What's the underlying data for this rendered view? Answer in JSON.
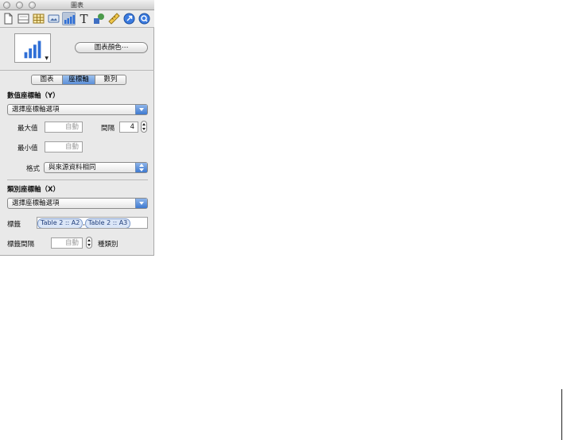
{
  "window": {
    "title": "圖表"
  },
  "toolbar": {
    "buttons": [
      {
        "icon": "document-icon"
      },
      {
        "icon": "layout-icon"
      },
      {
        "icon": "table-icon"
      },
      {
        "icon": "image-icon"
      },
      {
        "icon": "chart-icon",
        "selected": true
      },
      {
        "icon": "text-icon"
      },
      {
        "icon": "shapes-icon"
      },
      {
        "icon": "ruler-icon"
      },
      {
        "icon": "link-icon"
      },
      {
        "icon": "zoom-icon"
      }
    ],
    "text_glyph": "T"
  },
  "chart": {
    "colors_button": "圖表顏色⋯"
  },
  "tabs": [
    {
      "label": "圖表",
      "active": false
    },
    {
      "label": "座標軸",
      "active": true
    },
    {
      "label": "數列",
      "active": false
    }
  ],
  "value_axis": {
    "heading": "數值座標軸（Y）",
    "options_popup": "選擇座標軸選項",
    "max_label": "最大值",
    "max_value": "自動",
    "interval_label": "間隔",
    "interval_value": "4",
    "min_label": "最小值",
    "min_value": "自動",
    "format_label": "格式",
    "format_value": "與來源資料相同"
  },
  "category_axis": {
    "heading": "類別座標軸（X）",
    "options_popup": "選擇座標軸選項",
    "labels_label": "標籤",
    "label_tokens": [
      "Table 2 :: A2",
      "Table 2 :: A3"
    ],
    "token_separator": ",",
    "label_interval_label": "標籤間隔",
    "label_interval_value": "自動",
    "label_interval_suffix": "種類別"
  },
  "colors": {
    "accent": "#5b8fd8",
    "panel_bg": "#e9e9e9"
  }
}
